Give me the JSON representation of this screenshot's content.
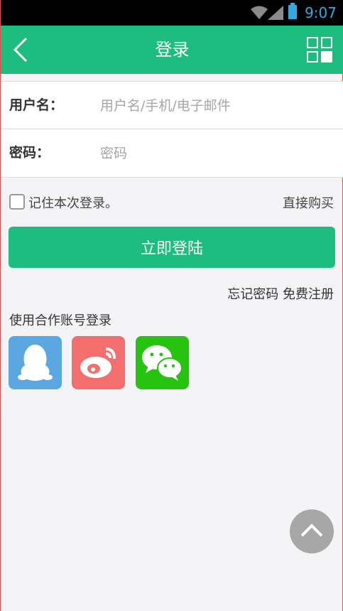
{
  "status_bar": {
    "time": "9:07",
    "icons": [
      "wifi-icon",
      "signal-icon",
      "battery-icon"
    ]
  },
  "header": {
    "title": "登录",
    "back_icon": "chevron-left-icon",
    "menu_icon": "grid-icon"
  },
  "form": {
    "username": {
      "label": "用户名：",
      "placeholder": "用户名/手机/电子邮件",
      "value": ""
    },
    "password": {
      "label": "密码：",
      "placeholder": "密码",
      "value": ""
    }
  },
  "remember": {
    "label": "记住本次登录。",
    "checked": false
  },
  "direct_buy": "直接购买",
  "login_button": "立即登陆",
  "links": {
    "forgot": "忘记密码",
    "register": "免费注册"
  },
  "partner_login": {
    "label": "使用合作账号登录",
    "providers": [
      {
        "icon": "qq-icon",
        "color": "#5aa7e2"
      },
      {
        "icon": "weibo-icon",
        "color": "#f36f6f"
      },
      {
        "icon": "wechat-icon",
        "color": "#27c311"
      }
    ]
  },
  "colors": {
    "primary": "#1dbd7f",
    "background": "#f4f4f6"
  },
  "scroll_top_icon": "chevron-up-icon"
}
